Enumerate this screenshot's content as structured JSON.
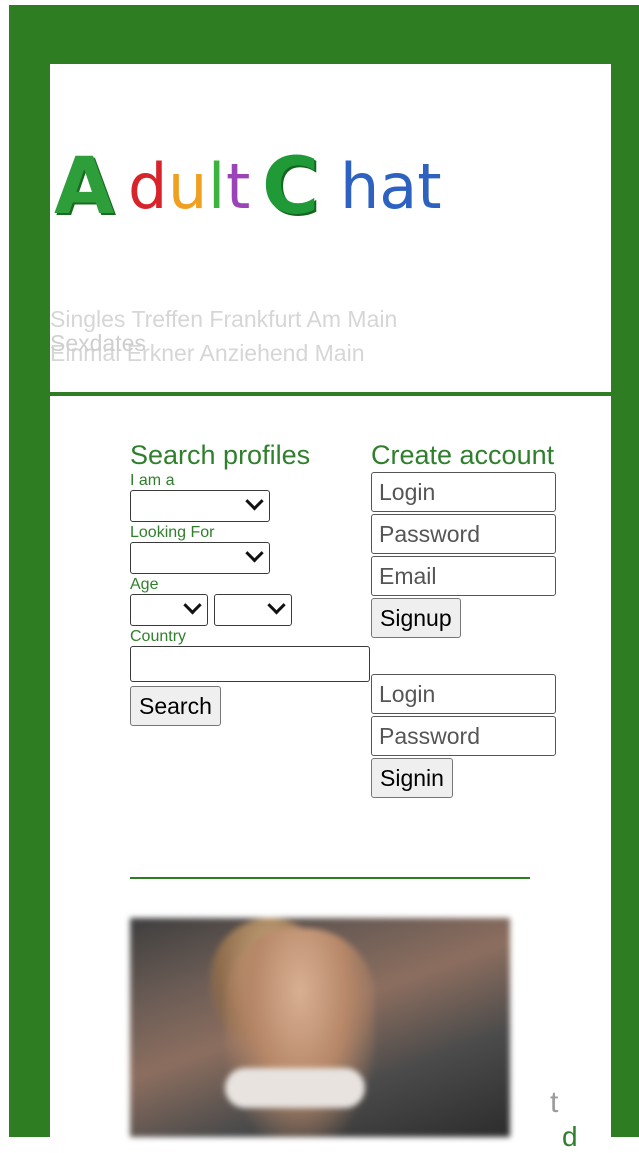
{
  "logo": {
    "text_parts": [
      "A",
      "dult",
      "C",
      "hat"
    ],
    "colors": {
      "A": "#2e9e3a",
      "d": "#d8232a",
      "u": "#f0a020",
      "l": "#3cb33c",
      "t": "#9b44b8",
      "C": "#1f9a37",
      "hat": "#2d62c0"
    }
  },
  "tagline": {
    "line1": "Singles Treffen Frankfurt Am Main",
    "line2": "Einmal Erkner Anziehend Main",
    "overlap": "Sexdates"
  },
  "search": {
    "title": "Search profiles",
    "i_am_label": "I am a",
    "looking_for_label": "Looking For",
    "age_label": "Age",
    "country_label": "Country",
    "search_button": "Search"
  },
  "create": {
    "title": "Create account",
    "login_placeholder": "Login",
    "password_placeholder": "Password",
    "email_placeholder": "Email",
    "signup_button": "Signup"
  },
  "signin": {
    "login_placeholder": "Login",
    "password_placeholder": "Password",
    "signin_button": "Signin"
  },
  "footer": {
    "char1": "t",
    "char2": "d"
  },
  "colors": {
    "frame": "#2e7d22",
    "label": "#2f7f2c"
  }
}
